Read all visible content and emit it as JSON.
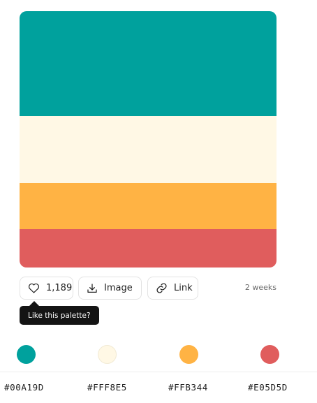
{
  "palette": {
    "colors": [
      "#00A19D",
      "#FFF8E5",
      "#FFB344",
      "#E05D5D"
    ]
  },
  "actions": {
    "likes_count": "1,189",
    "image_label": "Image",
    "link_label": "Link",
    "time_ago": "2 weeks",
    "tooltip": "Like this palette?"
  },
  "swatches": {
    "hex_labels": [
      "#00A19D",
      "#FFF8E5",
      "#FFB344",
      "#E05D5D"
    ]
  },
  "icons": {
    "like": "heart-icon",
    "image": "download-icon",
    "link": "link-icon"
  }
}
